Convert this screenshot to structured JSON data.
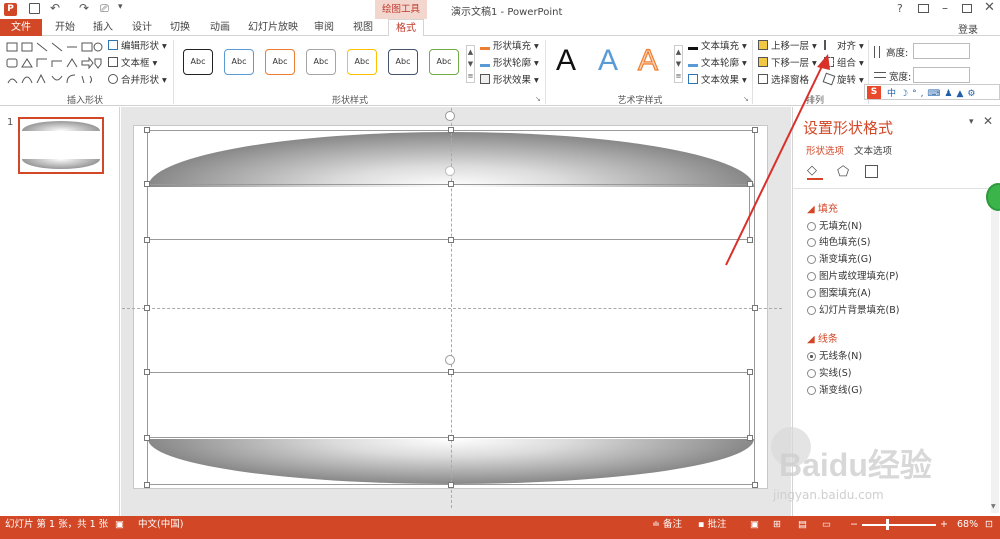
{
  "window": {
    "title": "演示文稿1 - PowerPoint",
    "context_tab": "绘图工具",
    "help": "?",
    "login": "登录"
  },
  "tabs": [
    "文件",
    "开始",
    "插入",
    "设计",
    "切换",
    "动画",
    "幻灯片放映",
    "审阅",
    "视图",
    "格式"
  ],
  "ribbon": {
    "insert_shapes": {
      "label": "插入形状",
      "edit_shape": "编辑形状",
      "textbox": "文本框",
      "merge_shapes": "合并形状"
    },
    "shape_styles": {
      "label": "形状样式",
      "preset_label": "Abc",
      "shape_fill": "形状填充",
      "shape_outline": "形状轮廓",
      "shape_effects": "形状效果"
    },
    "wordart": {
      "label": "艺术字样式",
      "sample": "A",
      "text_fill": "文本填充",
      "text_outline": "文本轮廓",
      "text_effects": "文本效果"
    },
    "arrange": {
      "label": "排列",
      "bring_forward": "上移一层",
      "send_backward": "下移一层",
      "selection_pane": "选择窗格",
      "align": "对齐",
      "group": "组合",
      "rotate": "旋转"
    },
    "size": {
      "height_label": "高度:",
      "width_label": "宽度:",
      "height_value": "",
      "width_value": ""
    }
  },
  "thumbnails": {
    "number": "1"
  },
  "format_pane": {
    "title": "设置形状格式",
    "tab_shape": "形状选项",
    "tab_text": "文本选项",
    "fill_section": "填充",
    "fill_options": [
      "无填充(N)",
      "纯色填充(S)",
      "渐变填充(G)",
      "图片或纹理填充(P)",
      "图案填充(A)",
      "幻灯片背景填充(B)"
    ],
    "line_section": "线条",
    "line_options": [
      "无线条(N)",
      "实线(S)",
      "渐变线(G)"
    ]
  },
  "watermark": {
    "line1": "Baidu经验",
    "line2": "jingyan.baidu.com"
  },
  "status": {
    "slide_info": "幻灯片 第 1 张，共 1 张",
    "language": "中文(中国)",
    "notes": "备注",
    "comments": "批注",
    "zoom": "68%"
  },
  "colors": {
    "accent": "#d24726",
    "annotation_arrow": "#d9302a"
  }
}
